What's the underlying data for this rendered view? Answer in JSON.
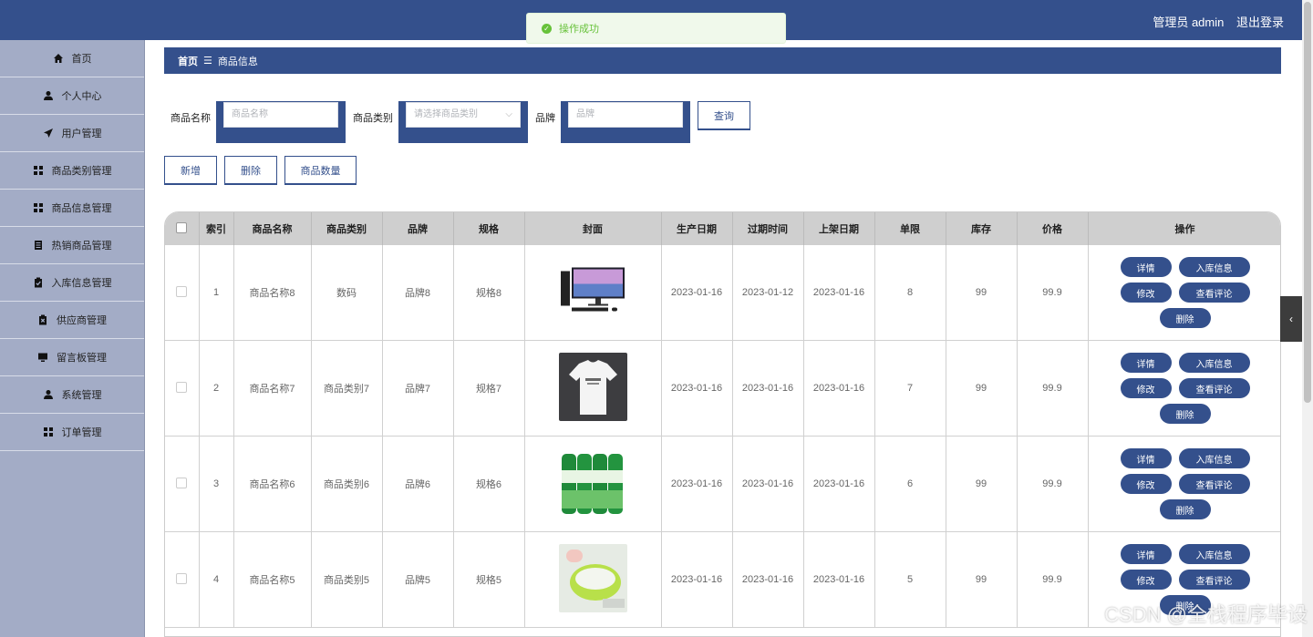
{
  "header": {
    "user_label": "管理员 admin",
    "logout_label": "退出登录"
  },
  "toast": {
    "message": "操作成功"
  },
  "sidebar": {
    "items": [
      {
        "label": "首页",
        "icon": "home-icon"
      },
      {
        "label": "个人中心",
        "icon": "user-icon"
      },
      {
        "label": "用户管理",
        "icon": "send-icon"
      },
      {
        "label": "商品类别管理",
        "icon": "grid-icon"
      },
      {
        "label": "商品信息管理",
        "icon": "grid-icon"
      },
      {
        "label": "热销商品管理",
        "icon": "document-icon"
      },
      {
        "label": "入库信息管理",
        "icon": "clipboard-check-icon"
      },
      {
        "label": "供应商管理",
        "icon": "clipboard-x-icon"
      },
      {
        "label": "留言板管理",
        "icon": "monitor-icon"
      },
      {
        "label": "系统管理",
        "icon": "user-icon"
      },
      {
        "label": "订单管理",
        "icon": "grid-icon"
      }
    ]
  },
  "breadcrumb": {
    "home": "首页",
    "separator": "☰",
    "current": "商品信息"
  },
  "search": {
    "name_label": "商品名称",
    "name_placeholder": "商品名称",
    "category_label": "商品类别",
    "category_placeholder": "请选择商品类别",
    "brand_label": "品牌",
    "brand_placeholder": "品牌",
    "query_label": "查询"
  },
  "actions": {
    "add": "新增",
    "delete": "删除",
    "quantity": "商品数量"
  },
  "table": {
    "headers": [
      "索引",
      "商品名称",
      "商品类别",
      "品牌",
      "规格",
      "封面",
      "生产日期",
      "过期时间",
      "上架日期",
      "单限",
      "库存",
      "价格",
      "操作"
    ],
    "row_actions": {
      "detail": "详情",
      "stock": "入库信息",
      "edit": "修改",
      "reviews": "查看评论",
      "delete": "删除"
    },
    "rows": [
      {
        "index": "1",
        "name": "商品名称8",
        "category": "数码",
        "brand": "品牌8",
        "spec": "规格8",
        "cover": "desktop-computer-image",
        "prod_date": "2023-01-16",
        "expire": "2023-01-12",
        "listed": "2023-01-16",
        "limit": "8",
        "stock": "99",
        "price": "99.9"
      },
      {
        "index": "2",
        "name": "商品名称7",
        "category": "商品类别7",
        "brand": "品牌7",
        "spec": "规格7",
        "cover": "tshirt-image",
        "prod_date": "2023-01-16",
        "expire": "2023-01-16",
        "listed": "2023-01-16",
        "limit": "7",
        "stock": "99",
        "price": "99.9"
      },
      {
        "index": "3",
        "name": "商品名称6",
        "category": "商品类别6",
        "brand": "品牌6",
        "spec": "规格6",
        "cover": "aloe-drink-image",
        "prod_date": "2023-01-16",
        "expire": "2023-01-16",
        "listed": "2023-01-16",
        "limit": "6",
        "stock": "99",
        "price": "99.9"
      },
      {
        "index": "4",
        "name": "商品名称5",
        "category": "商品类别5",
        "brand": "品牌5",
        "spec": "规格5",
        "cover": "green-bowl-image",
        "prod_date": "2023-01-16",
        "expire": "2023-01-16",
        "listed": "2023-01-16",
        "limit": "5",
        "stock": "99",
        "price": "99.9"
      }
    ]
  },
  "watermark": "CSDN @全栈程序毕设",
  "colors": {
    "primary": "#34508c",
    "sidebar": "#a3acc6",
    "success": "#67c23a"
  }
}
